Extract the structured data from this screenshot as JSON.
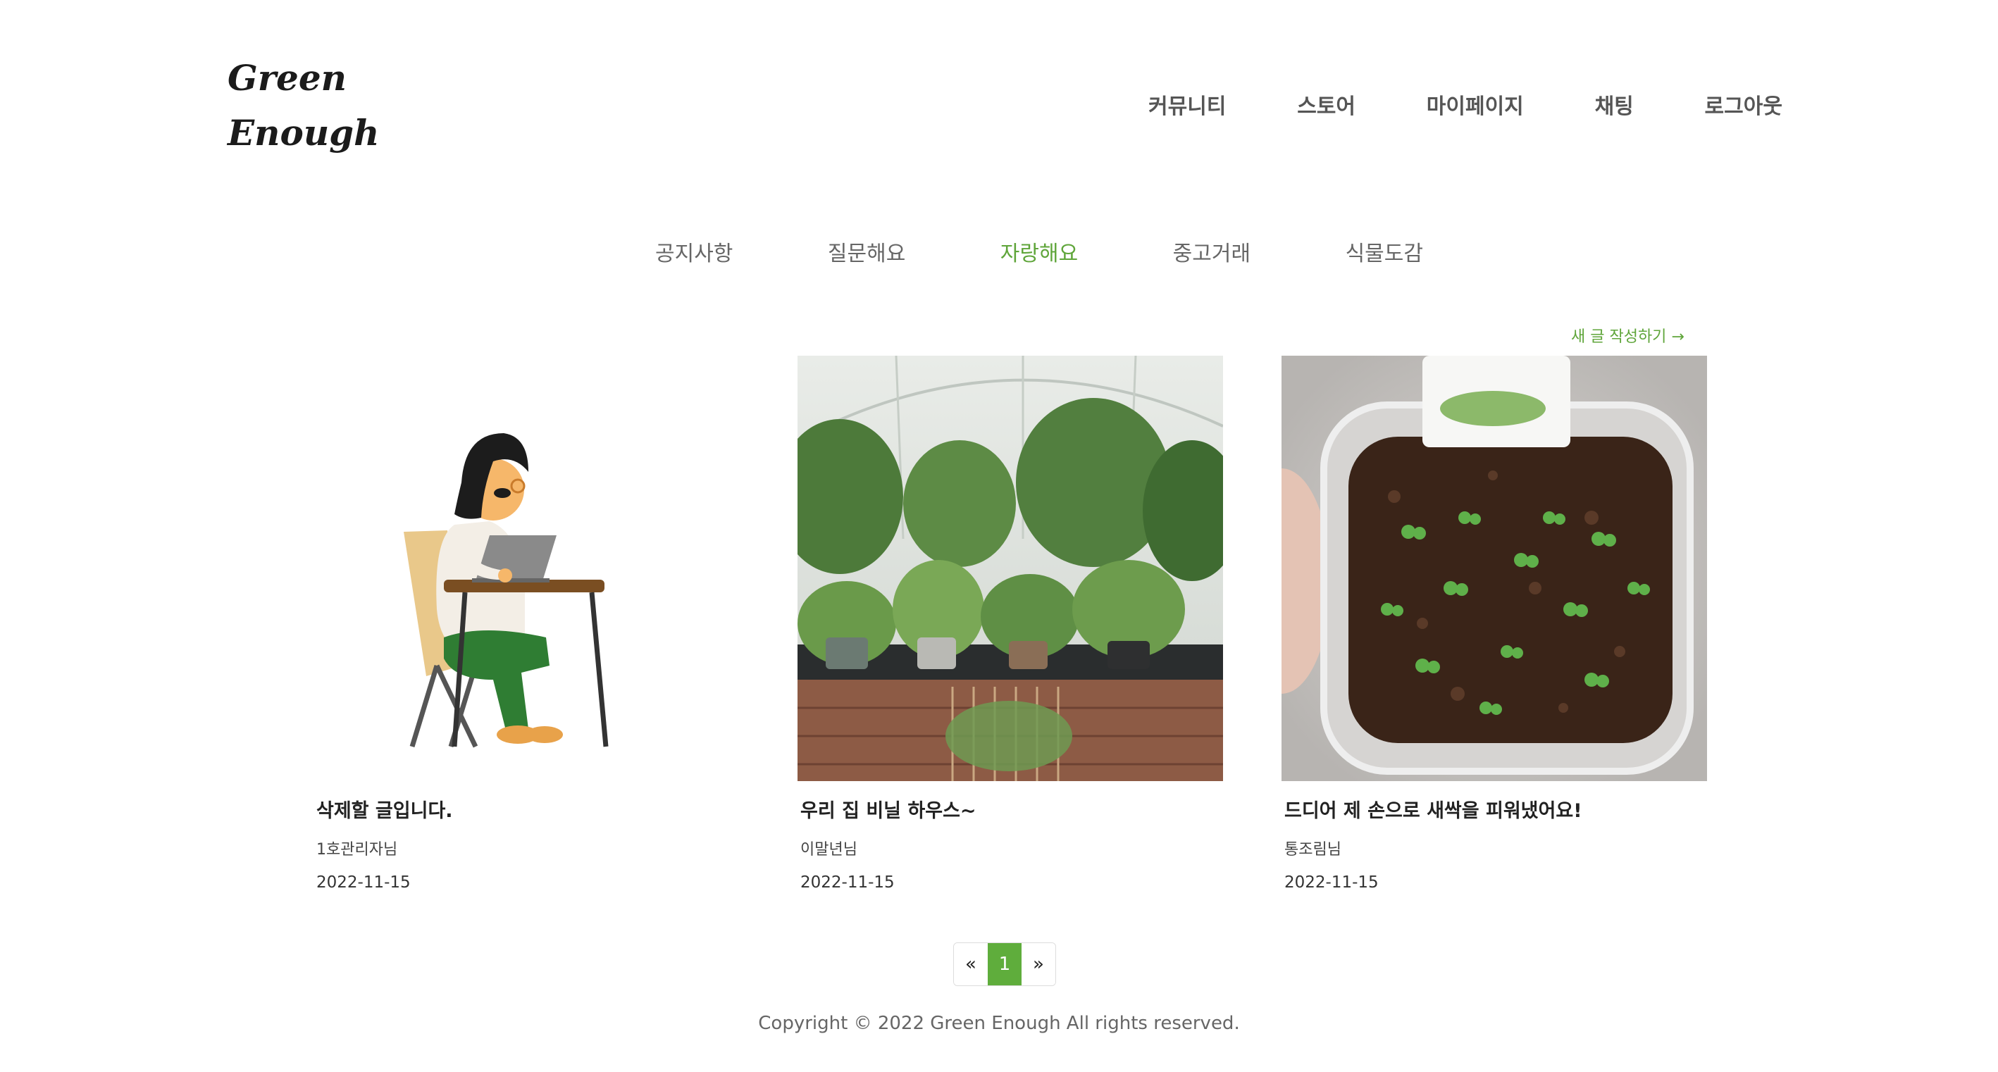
{
  "header": {
    "logo": "Green\nEnough",
    "nav": [
      "커뮤니티",
      "스토어",
      "마이페이지",
      "채팅",
      "로그아웃"
    ]
  },
  "community_tabs": {
    "items": [
      "공지사항",
      "질문해요",
      "자랑해요",
      "중고거래",
      "식물도감"
    ],
    "active": "자랑해요"
  },
  "write_link": "새 글 작성하기 →",
  "posts": [
    {
      "title": "삭제할 글입니다.",
      "author": "1호관리자님",
      "date": "2022-11-15",
      "image": "illustration-woman-laptop"
    },
    {
      "title": "우리 집 비닐 하우스~",
      "author": "이말년님",
      "date": "2022-11-15",
      "image": "photo-greenhouse-plants"
    },
    {
      "title": "드디어 제 손으로 새싹을 피워냈어요!",
      "author": "통조림님",
      "date": "2022-11-15",
      "image": "photo-seedlings-container"
    }
  ],
  "pagination": {
    "prev": "«",
    "current": "1",
    "next": "»"
  },
  "footer": {
    "copyright": "Copyright © 2022 Green Enough All rights reserved."
  },
  "colors": {
    "accent": "#5fa53a",
    "pagination_active": "#5fad3c"
  }
}
